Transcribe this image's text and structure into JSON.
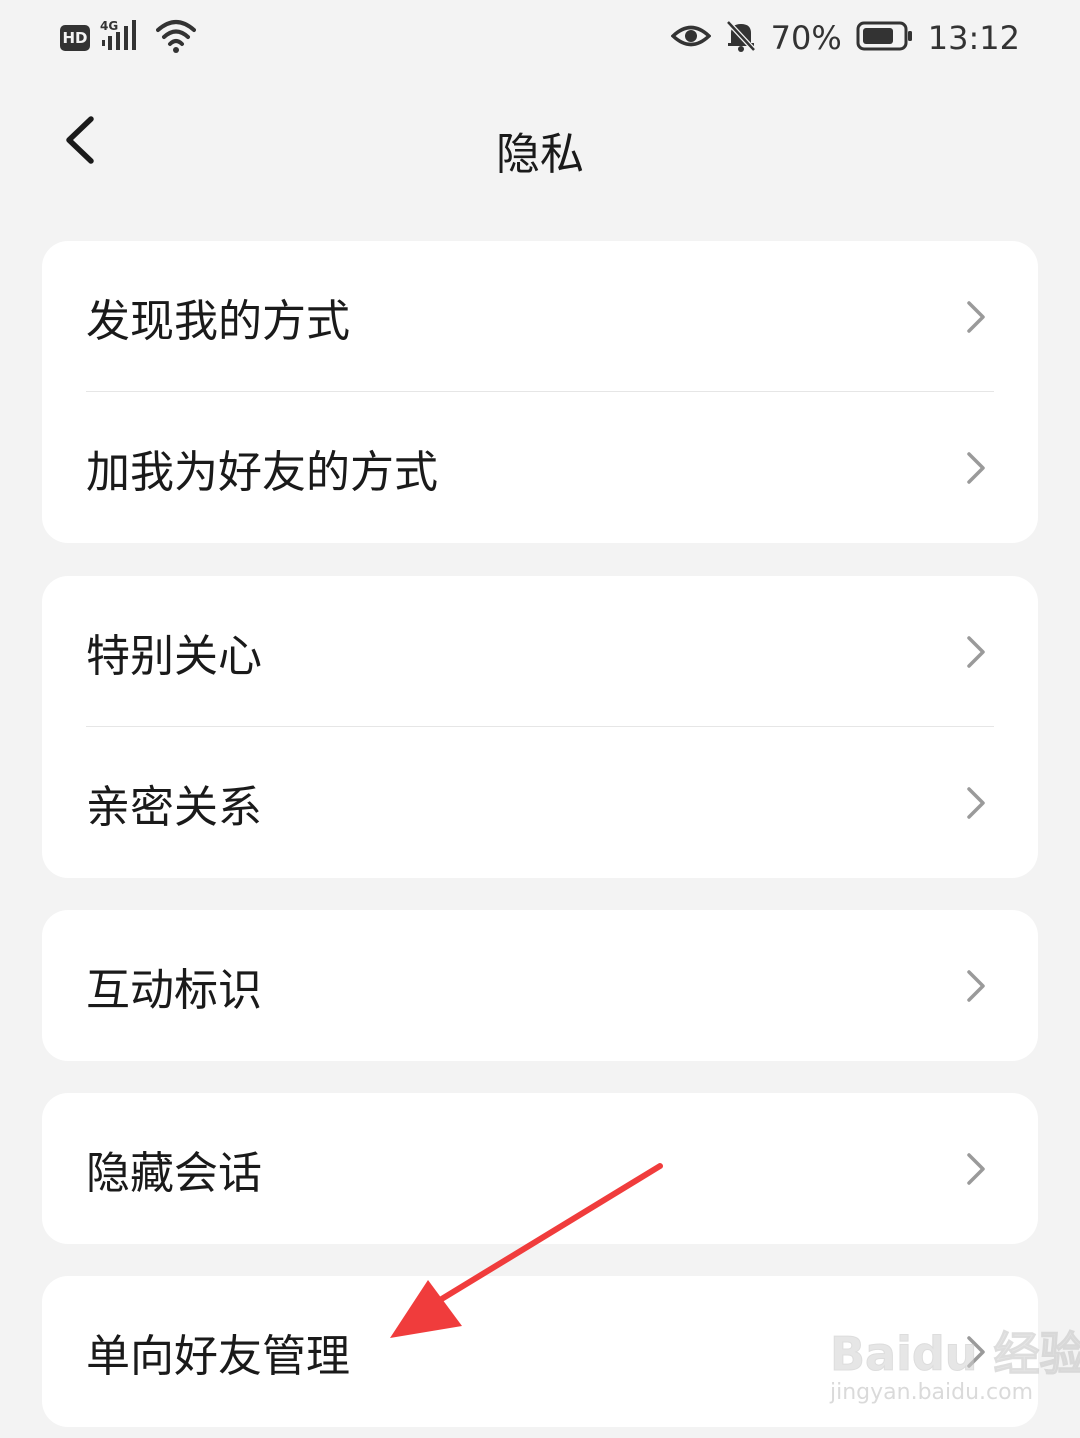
{
  "status_bar": {
    "network_badge": "HD",
    "network_type": "4G",
    "battery_percent": "70%",
    "time": "13:12",
    "icons": [
      "hd-badge",
      "signal-icon",
      "wifi-icon",
      "eye-icon",
      "bell-muted-icon",
      "battery-icon"
    ]
  },
  "header": {
    "back_icon": "chevron-left-icon",
    "title": "隐私"
  },
  "groups": [
    {
      "items": [
        {
          "label": "发现我的方式"
        },
        {
          "label": "加我为好友的方式"
        }
      ]
    },
    {
      "items": [
        {
          "label": "特别关心"
        },
        {
          "label": "亲密关系"
        }
      ]
    },
    {
      "items": [
        {
          "label": "互动标识"
        }
      ]
    },
    {
      "items": [
        {
          "label": "隐藏会话"
        }
      ]
    },
    {
      "items": [
        {
          "label": "单向好友管理"
        }
      ]
    }
  ],
  "annotation": {
    "arrow_color": "#f03c3c"
  },
  "watermark": {
    "main": "Baidu 经验",
    "sub": "jingyan.baidu.com"
  },
  "colors": {
    "background": "#f3f3f3",
    "card": "#ffffff",
    "text": "#1a1a1a",
    "chevron": "#9a9a9a"
  }
}
